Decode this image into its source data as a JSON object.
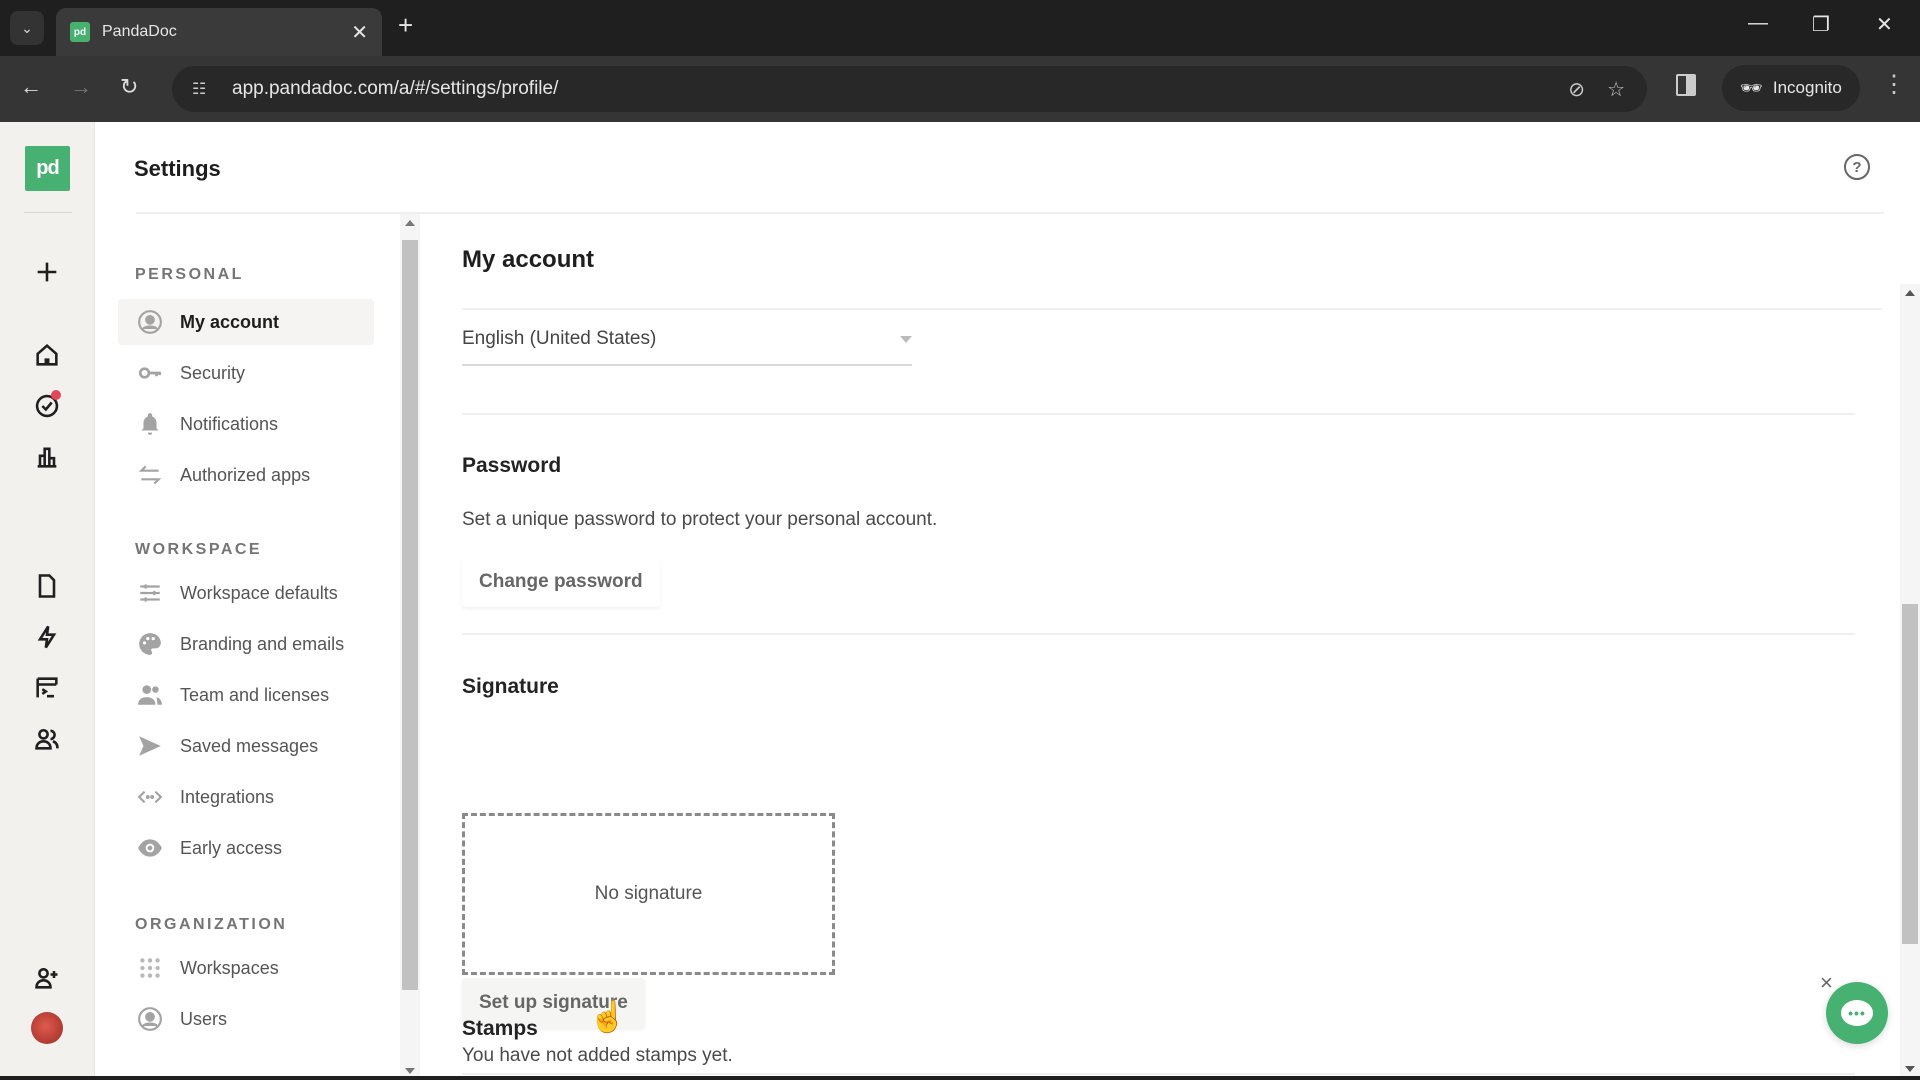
{
  "browser": {
    "tab_title": "PandaDoc",
    "favicon_text": "pd",
    "url": "app.pandadoc.com/a/#/settings/profile/",
    "incognito_label": "Incognito"
  },
  "app": {
    "logo_text": "pd",
    "brand_color": "#47b172",
    "header_title": "Settings",
    "help_label": "?"
  },
  "sidebar": {
    "sections": [
      {
        "title": "PERSONAL",
        "items": [
          {
            "label": "My account",
            "icon": "user-circle-icon",
            "active": true
          },
          {
            "label": "Security",
            "icon": "key-icon"
          },
          {
            "label": "Notifications",
            "icon": "bell-icon"
          },
          {
            "label": "Authorized apps",
            "icon": "arrows-swap-icon"
          }
        ]
      },
      {
        "title": "WORKSPACE",
        "items": [
          {
            "label": "Workspace defaults",
            "icon": "sliders-icon"
          },
          {
            "label": "Branding and emails",
            "icon": "palette-icon"
          },
          {
            "label": "Team and licenses",
            "icon": "team-icon"
          },
          {
            "label": "Saved messages",
            "icon": "send-icon"
          },
          {
            "label": "Integrations",
            "icon": "code-icon"
          },
          {
            "label": "Early access",
            "icon": "eye-icon"
          }
        ]
      },
      {
        "title": "ORGANIZATION",
        "items": [
          {
            "label": "Workspaces",
            "icon": "grid-icon"
          },
          {
            "label": "Users",
            "icon": "user-circle-icon"
          }
        ]
      }
    ]
  },
  "main": {
    "heading": "My account",
    "language": {
      "selected": "English (United States)"
    },
    "password": {
      "title": "Password",
      "description": "Set a unique password to protect your personal account.",
      "button": "Change password"
    },
    "signature": {
      "title": "Signature",
      "empty_text": "No signature",
      "button": "Set up signature"
    },
    "stamps": {
      "title": "Stamps",
      "empty_text": "You have not added stamps yet."
    }
  },
  "chat": {
    "close_label": "×",
    "bubble_text": "•••"
  }
}
